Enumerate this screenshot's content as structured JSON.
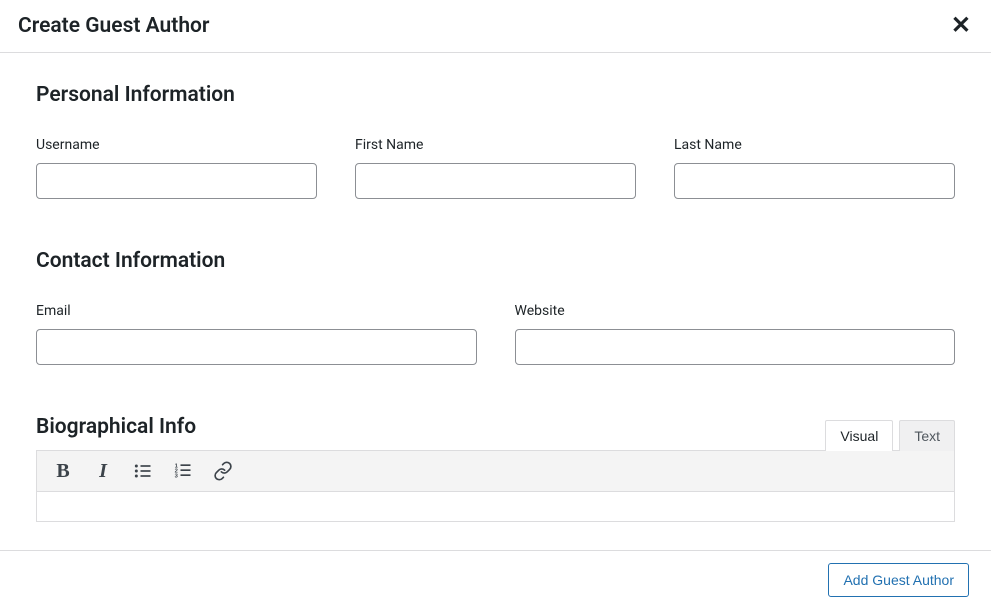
{
  "header": {
    "title": "Create Guest Author"
  },
  "sections": {
    "personal": {
      "title": "Personal Information",
      "username_label": "Username",
      "firstname_label": "First Name",
      "lastname_label": "Last Name",
      "username_value": "",
      "firstname_value": "",
      "lastname_value": ""
    },
    "contact": {
      "title": "Contact Information",
      "email_label": "Email",
      "website_label": "Website",
      "email_value": "",
      "website_value": ""
    },
    "bio": {
      "title": "Biographical Info",
      "tab_visual": "Visual",
      "tab_text": "Text"
    }
  },
  "footer": {
    "submit_label": "Add Guest Author"
  }
}
